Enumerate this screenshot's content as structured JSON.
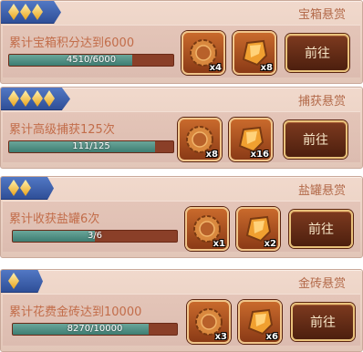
{
  "bounties": [
    {
      "category": "宝箱悬赏",
      "stars": 3,
      "task": "累计宝箱积分达到6000",
      "progress_text": "4510/6000",
      "progress_fraction": 0.7517,
      "rewards": [
        {
          "icon": "gear-coin-icon",
          "count": "x4"
        },
        {
          "icon": "amber-crystal-icon",
          "count": "x8"
        }
      ],
      "button": "前往"
    },
    {
      "category": "捕获悬赏",
      "stars": 4,
      "task": "累计高级捕获125次",
      "progress_text": "111/125",
      "progress_fraction": 0.888,
      "rewards": [
        {
          "icon": "gear-coin-icon",
          "count": "x8"
        },
        {
          "icon": "amber-crystal-icon",
          "count": "x16"
        }
      ],
      "button": "前往"
    },
    {
      "category": "盐罐悬赏",
      "stars": 2,
      "task": "累计收获盐罐6次",
      "progress_text": "3/6",
      "progress_fraction": 0.5,
      "rewards": [
        {
          "icon": "gear-coin-icon",
          "count": "x1"
        },
        {
          "icon": "amber-crystal-icon",
          "count": "x2"
        }
      ],
      "button": "前往"
    },
    {
      "category": "金砖悬赏",
      "stars": 1,
      "task": "累计花费金砖达到10000",
      "progress_text": "8270/10000",
      "progress_fraction": 0.827,
      "rewards": [
        {
          "icon": "gear-coin-icon",
          "count": "x3"
        },
        {
          "icon": "amber-crystal-icon",
          "count": "x6"
        }
      ],
      "button": "前往"
    }
  ]
}
